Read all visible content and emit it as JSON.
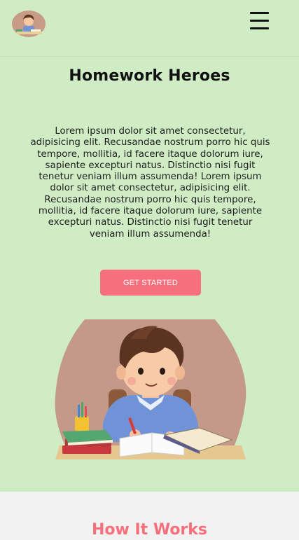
{
  "header": {
    "logo_icon": "boy-studying-logo",
    "menu_icon": "hamburger-menu-icon"
  },
  "hero": {
    "title": "Homework Heroes",
    "description": "Lorem ipsum dolor sit amet consectetur, adipisicing elit. Recusandae nostrum porro hic quis tempore, mollitia, id facere itaque dolorum iure, sapiente excepturi natus. Distinctio nisi fugit tenetur veniam illum assumenda! Lorem ipsum dolor sit amet consectetur, adipisicing elit. Recusandae nostrum porro hic quis tempore, mollitia, id facere itaque dolorum iure, sapiente excepturi natus. Distinctio nisi fugit tenetur veniam illum assumenda!",
    "cta_label": "GET STARTED",
    "illustration": "boy-doing-homework-illustration"
  },
  "how_it_works": {
    "title": "How It Works"
  },
  "colors": {
    "page_background": "#d0ecc5",
    "accent": "#f56f7c",
    "section_background": "#f2f2f2"
  }
}
